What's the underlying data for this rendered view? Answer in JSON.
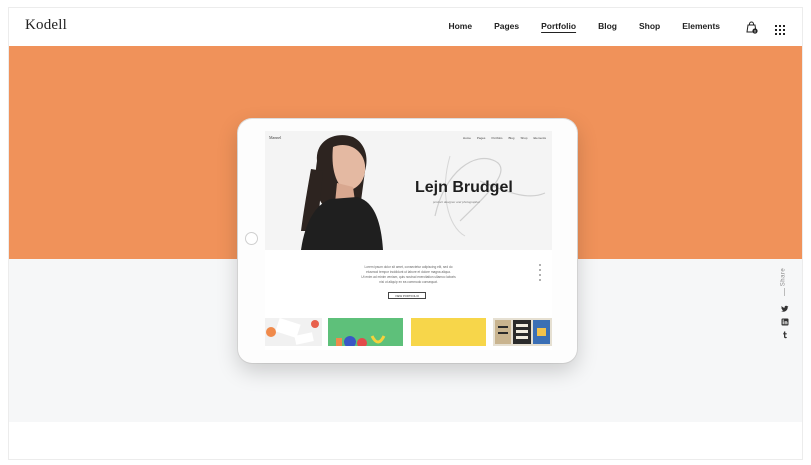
{
  "header": {
    "logo": "Kodell",
    "nav": [
      "Home",
      "Pages",
      "Portfolio",
      "Blog",
      "Shop",
      "Elements"
    ],
    "active_nav": "Portfolio",
    "cart_icon": "shopping-bag-icon",
    "cart_count": "0",
    "menu_icon": "grid-menu-icon"
  },
  "colors": {
    "hero_accent": "#f0925a",
    "hero_bottom": "#f6f7f8"
  },
  "share": {
    "label": "Share",
    "icons": [
      "twitter-icon",
      "linkedin-icon",
      "tumblr-icon"
    ]
  },
  "tablet": {
    "screen": {
      "logo": "Mannel",
      "nav": [
        "Home",
        "Pages",
        "Portfolio",
        "Blog",
        "Shop",
        "Elements"
      ],
      "hero_title": "Lejn Brudgel",
      "hero_subtitle": "product designer and photographer",
      "text_lines": [
        "Lorem ipsum dolor sit amet, consectetur adipiscing elit, sed do",
        "eiusmod tempor incididunt ut labore et dolore magna aliqua.",
        "Ut enim ad minim veniam, quis nostrud exercitation ullamco laboris",
        "nisi ut aliquip ex ea commodo consequat."
      ],
      "button_label": "VIEW PORTFOLIO"
    }
  }
}
